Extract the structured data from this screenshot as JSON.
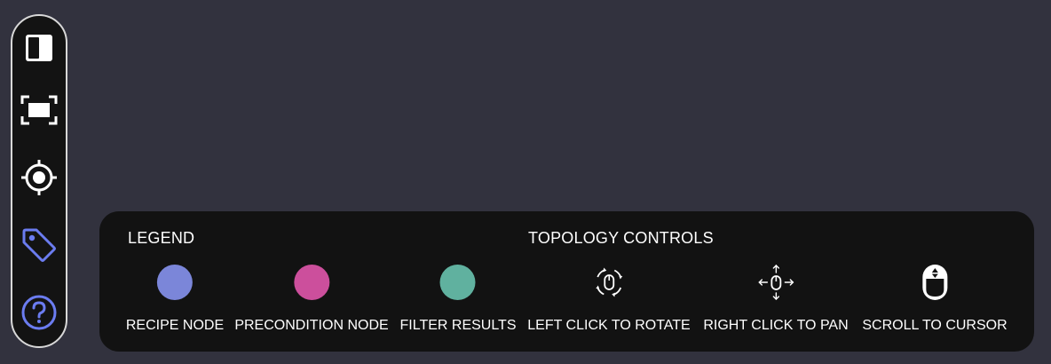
{
  "toolbar": {
    "tools": [
      {
        "name": "panel-toggle-icon"
      },
      {
        "name": "fit-view-icon"
      },
      {
        "name": "target-icon"
      },
      {
        "name": "tag-icon",
        "color": "#6b7cf0"
      },
      {
        "name": "help-icon",
        "color": "#6b7cf0"
      }
    ]
  },
  "panel": {
    "legend_title": "LEGEND",
    "controls_title": "TOPOLOGY CONTROLS",
    "legend_items": [
      {
        "label": "RECIPE NODE",
        "color": "#7b86d9"
      },
      {
        "label": "PRECONDITION NODE",
        "color": "#cc4f9c"
      },
      {
        "label": "FILTER RESULTS",
        "color": "#60b19f"
      }
    ],
    "control_items": [
      {
        "label": "LEFT CLICK TO ROTATE",
        "icon": "mouse-rotate-icon"
      },
      {
        "label": "RIGHT CLICK TO PAN",
        "icon": "mouse-pan-icon"
      },
      {
        "label": "SCROLL TO CURSOR",
        "icon": "mouse-scroll-icon"
      }
    ]
  }
}
